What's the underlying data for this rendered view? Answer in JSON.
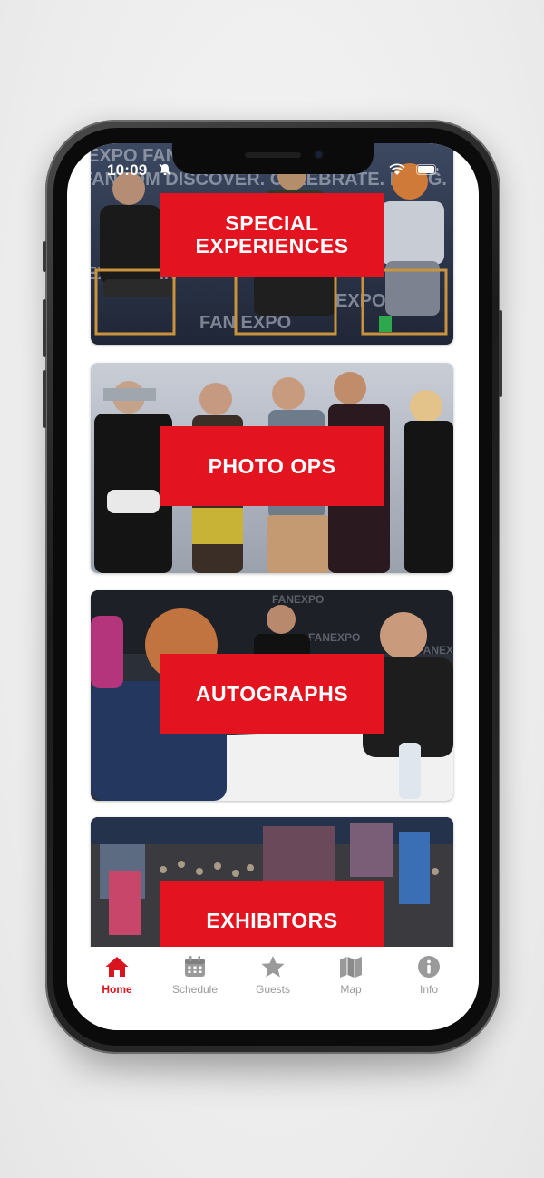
{
  "status_bar": {
    "time": "10:09"
  },
  "cards": [
    {
      "id": "special-experiences",
      "lines": [
        "SPECIAL",
        "EXPERIENCES"
      ]
    },
    {
      "id": "photo-ops",
      "lines": [
        "PHOTO OPS"
      ]
    },
    {
      "id": "autographs",
      "lines": [
        "AUTOGRAPHS"
      ]
    },
    {
      "id": "exhibitors",
      "lines": [
        "EXHIBITORS"
      ]
    }
  ],
  "tab_bar": {
    "items": [
      {
        "label": "Home",
        "icon": "home-icon",
        "active": true
      },
      {
        "label": "Schedule",
        "icon": "calendar-icon",
        "active": false
      },
      {
        "label": "Guests",
        "icon": "star-icon",
        "active": false
      },
      {
        "label": "Map",
        "icon": "map-icon",
        "active": false
      },
      {
        "label": "Info",
        "icon": "info-icon",
        "active": false
      }
    ]
  },
  "colors": {
    "accent": "#e3141f",
    "tab_active": "#d8141e",
    "tab_inactive": "#9a9a9a"
  }
}
